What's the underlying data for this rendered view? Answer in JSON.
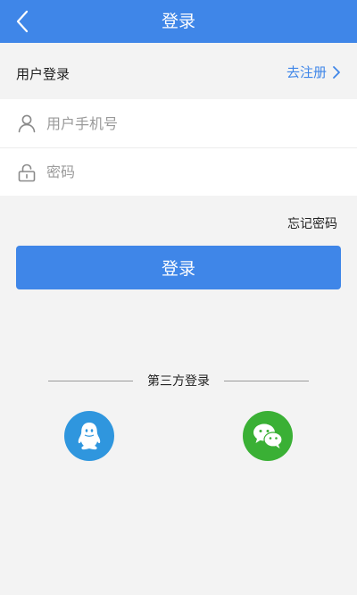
{
  "navbar": {
    "title": "登录",
    "back_icon": "chevron-left-icon"
  },
  "login_header": {
    "title": "用户登录",
    "register_label": "去注册"
  },
  "fields": {
    "phone": {
      "placeholder": "用户手机号",
      "value": "",
      "icon": "user-icon"
    },
    "password": {
      "placeholder": "密码",
      "value": "",
      "icon": "lock-icon"
    }
  },
  "forgot_label": "忘记密码",
  "login_button_label": "登录",
  "third_party": {
    "title": "第三方登录",
    "providers": [
      {
        "icon": "qq-icon",
        "color": "#2f96de"
      },
      {
        "icon": "wechat-icon",
        "color": "#3ab035"
      }
    ]
  },
  "colors": {
    "accent": "#3f86e8",
    "background": "#f3f3f3"
  }
}
